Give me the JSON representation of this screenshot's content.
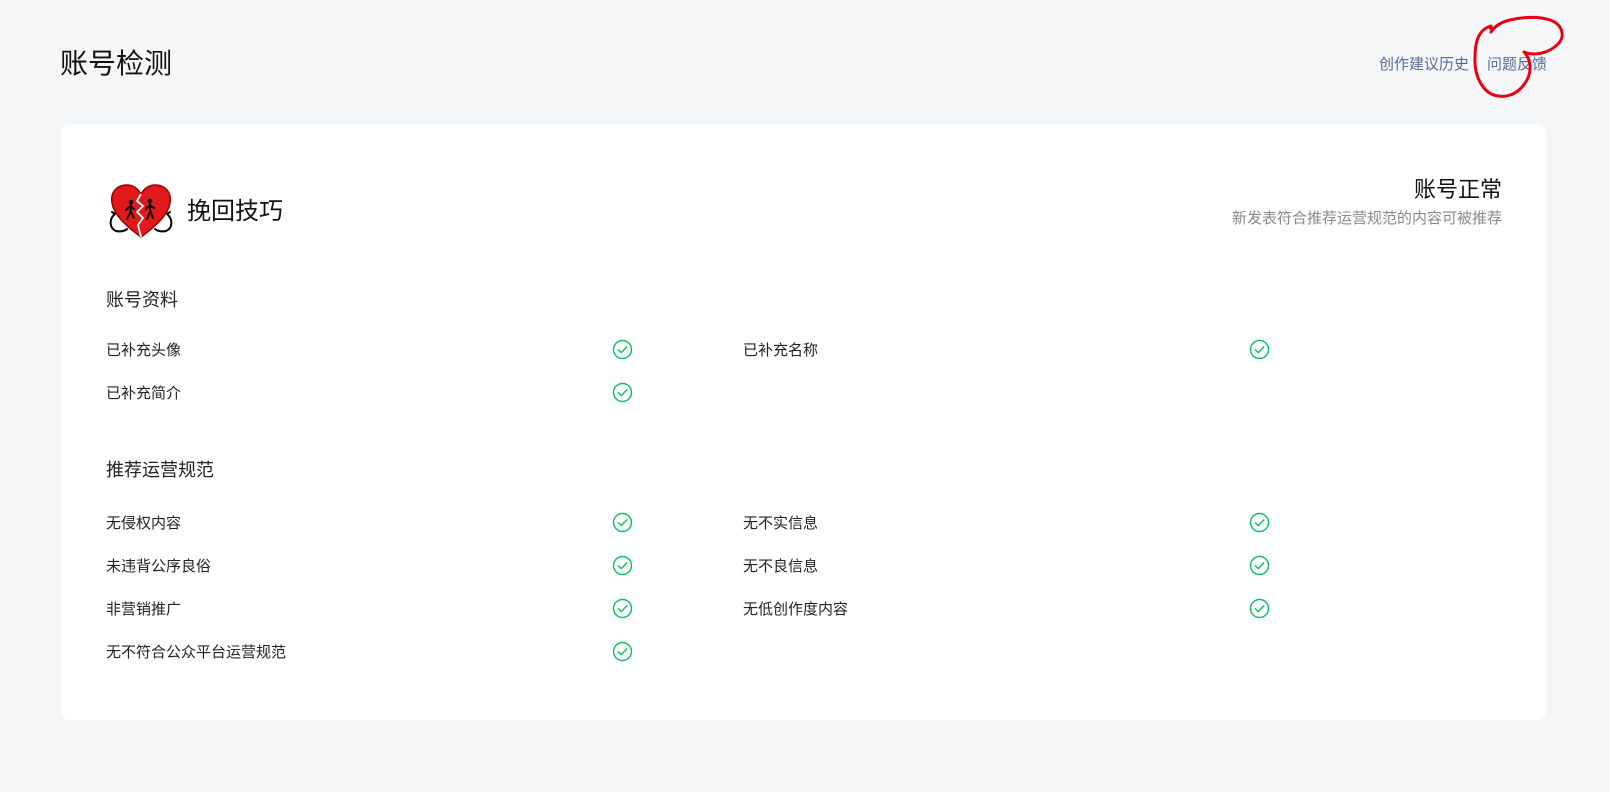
{
  "header": {
    "title": "账号检测",
    "links": [
      "创作建议历史",
      "问题反馈"
    ]
  },
  "account": {
    "avatar_icon": "broken-heart-couple-icon",
    "name": "挽回技巧"
  },
  "status": {
    "title": "账号正常",
    "description": "新发表符合推荐运营规范的内容可被推荐"
  },
  "sections": [
    {
      "title": "账号资料",
      "items": [
        {
          "label": "已补充头像",
          "status": "passed"
        },
        {
          "label": "已补充名称",
          "status": "passed"
        },
        {
          "label": "已补充简介",
          "status": "passed"
        }
      ]
    },
    {
      "title": "推荐运营规范",
      "items": [
        {
          "label": "无侵权内容",
          "status": "passed"
        },
        {
          "label": "无不实信息",
          "status": "passed"
        },
        {
          "label": "未违背公序良俗",
          "status": "passed"
        },
        {
          "label": "无不良信息",
          "status": "passed"
        },
        {
          "label": "非营销推广",
          "status": "passed"
        },
        {
          "label": "无低创作度内容",
          "status": "passed"
        },
        {
          "label": "无不符合公众平台运营规范",
          "status": "passed"
        }
      ]
    }
  ],
  "colors": {
    "check_green": "#07c160",
    "link_blue": "#576b95",
    "annotation_red": "#e60012"
  }
}
